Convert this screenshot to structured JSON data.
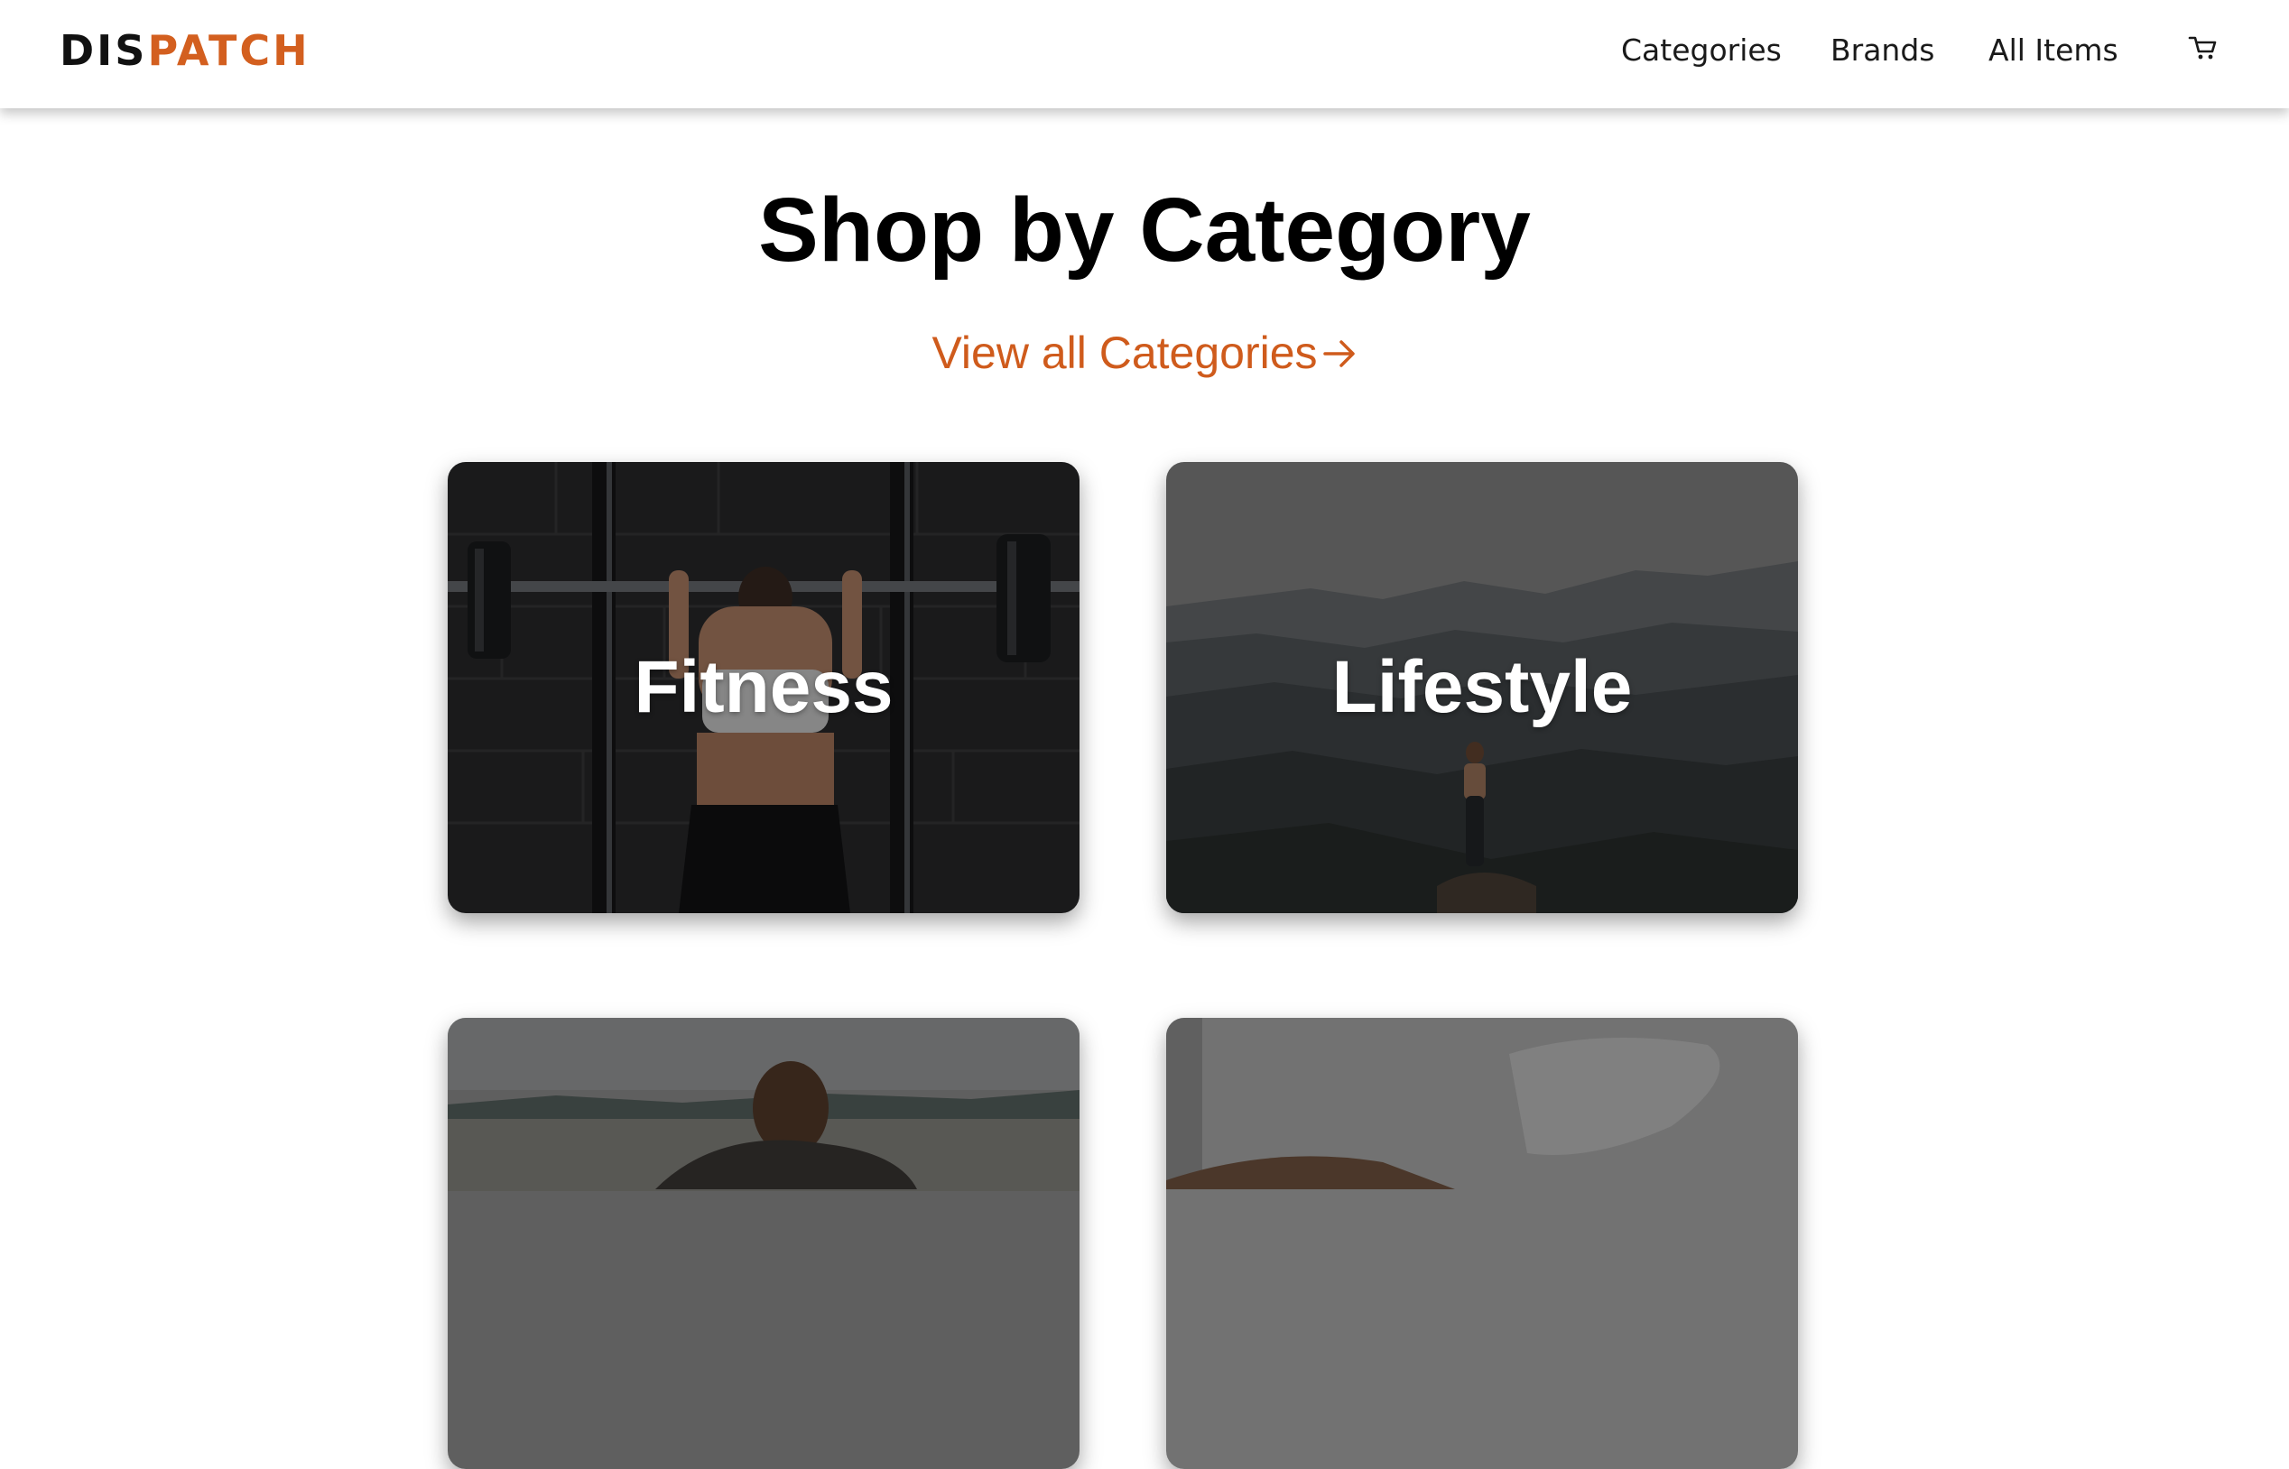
{
  "header": {
    "logo": {
      "part1": "DIS",
      "part2": "PATCH"
    },
    "nav": [
      {
        "label": "Categories"
      },
      {
        "label": "Brands"
      },
      {
        "label": "All Items"
      }
    ],
    "cart_icon": "cart-icon"
  },
  "main": {
    "title": "Shop by Category",
    "view_all": {
      "label": "View all Categories",
      "icon": "arrow-right-icon"
    },
    "categories": [
      {
        "label": "Fitness"
      },
      {
        "label": "Lifestyle"
      },
      {
        "label": ""
      },
      {
        "label": ""
      }
    ]
  },
  "colors": {
    "accent": "#d35f1f",
    "link": "#cf5b1c",
    "text": "#000000",
    "header_bg": "#ffffff"
  }
}
